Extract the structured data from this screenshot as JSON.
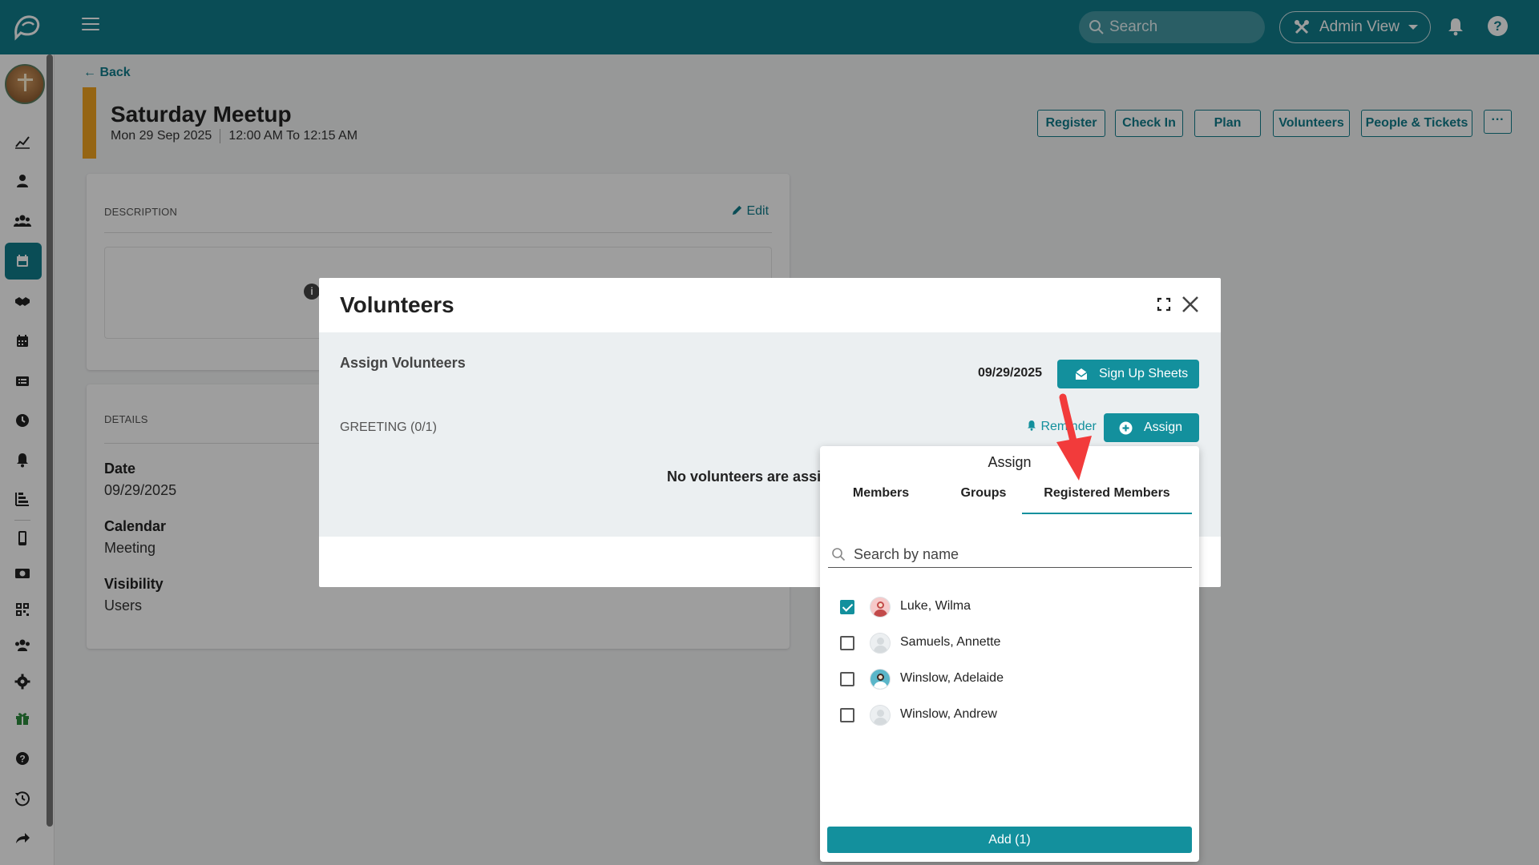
{
  "topbar": {
    "search_placeholder": "Search",
    "admin_view_label": "Admin View",
    "help_label": "?"
  },
  "page": {
    "back_label": "Back",
    "event_title": "Saturday Meetup",
    "event_date": "Mon 29 Sep  2025",
    "event_time": "12:00 AM To 12:15 AM",
    "accent_color": "#f0a31f",
    "header_buttons": [
      "Register",
      "Check In",
      "Plan",
      "Volunteers",
      "People & Tickets",
      "···"
    ]
  },
  "description_card": {
    "label": "DESCRIPTION",
    "edit_label": "Edit",
    "info_icon_text": "i"
  },
  "details_card": {
    "label": "DETAILS",
    "fields": [
      {
        "label": "Date",
        "value": "09/29/2025"
      },
      {
        "label": "Calendar",
        "value": "Meeting"
      },
      {
        "label": "Visibility",
        "value": "Users"
      }
    ]
  },
  "modal": {
    "title": "Volunteers",
    "assign_volunteers": "Assign Volunteers",
    "date": "09/29/2025",
    "signup_label": "Sign Up Sheets",
    "greeting": "GREETING (0/1)",
    "reminder_label": "Reminder",
    "assign_label": "Assign",
    "no_volunteers": "No volunteers are assig"
  },
  "assign_popup": {
    "title": "Assign",
    "tabs": [
      "Members",
      "Groups",
      "Registered Members"
    ],
    "active_tab": "Registered Members",
    "search_placeholder": "Search by name",
    "people": [
      {
        "name": "Luke, Wilma",
        "checked": true
      },
      {
        "name": "Samuels, Annette",
        "checked": false
      },
      {
        "name": "Winslow, Adelaide",
        "checked": false
      },
      {
        "name": "Winslow, Andrew",
        "checked": false
      }
    ],
    "add_label": "Add (1)"
  },
  "colors": {
    "brand_teal": "#117c8b",
    "button_teal": "#13909d",
    "annotation_arrow": "#f23b3b"
  }
}
